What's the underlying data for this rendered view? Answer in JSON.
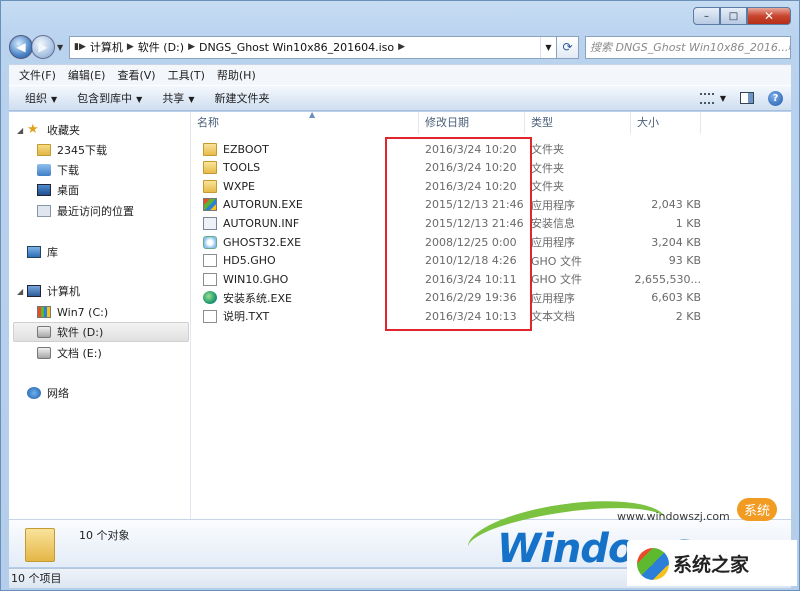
{
  "caption": {
    "minimize": "–",
    "maximize": "□",
    "close": "✕"
  },
  "address": {
    "crumbs": [
      "计算机",
      "软件 (D:)",
      "DNGS_Ghost Win10x86_201604.iso"
    ],
    "search_placeholder": "搜索 DNGS_Ghost Win10x86_2016..."
  },
  "menu": [
    "文件(F)",
    "编辑(E)",
    "查看(V)",
    "工具(T)",
    "帮助(H)"
  ],
  "toolbar": {
    "organize": "组织",
    "include_library": "包含到库中",
    "share": "共享",
    "new_folder": "新建文件夹"
  },
  "nav": {
    "favorites": "收藏夹",
    "fav_items": [
      "2345下载",
      "下载",
      "桌面",
      "最近访问的位置"
    ],
    "libraries": "库",
    "computer": "计算机",
    "drives": [
      "Win7 (C:)",
      "软件 (D:)",
      "文档 (E:)"
    ],
    "network": "网络"
  },
  "columns": {
    "name": "名称",
    "date": "修改日期",
    "type": "类型",
    "size": "大小"
  },
  "files": [
    {
      "name": "EZBOOT",
      "date": "2016/3/24 10:20",
      "type": "文件夹",
      "size": "",
      "icon": "folder-icon"
    },
    {
      "name": "TOOLS",
      "date": "2016/3/24 10:20",
      "type": "文件夹",
      "size": "",
      "icon": "folder-icon"
    },
    {
      "name": "WXPE",
      "date": "2016/3/24 10:20",
      "type": "文件夹",
      "size": "",
      "icon": "folder-icon"
    },
    {
      "name": "AUTORUN.EXE",
      "date": "2015/12/13 21:46",
      "type": "应用程序",
      "size": "2,043 KB",
      "icon": "exe-icon"
    },
    {
      "name": "AUTORUN.INF",
      "date": "2015/12/13 21:46",
      "type": "安装信息",
      "size": "1 KB",
      "icon": "inf-icon"
    },
    {
      "name": "GHOST32.EXE",
      "date": "2008/12/25 0:00",
      "type": "应用程序",
      "size": "3,204 KB",
      "icon": "ghost-icon"
    },
    {
      "name": "HD5.GHO",
      "date": "2010/12/18 4:26",
      "type": "GHO 文件",
      "size": "93 KB",
      "icon": "document-icon"
    },
    {
      "name": "WIN10.GHO",
      "date": "2016/3/24 10:11",
      "type": "GHO 文件",
      "size": "2,655,530...",
      "icon": "document-icon"
    },
    {
      "name": "安装系统.EXE",
      "date": "2016/2/29 19:36",
      "type": "应用程序",
      "size": "6,603 KB",
      "icon": "setup-icon"
    },
    {
      "name": "说明.TXT",
      "date": "2016/3/24 10:13",
      "type": "文本文档",
      "size": "2 KB",
      "icon": "document-icon"
    }
  ],
  "details": {
    "count": "10 个对象"
  },
  "status": {
    "count": "10 个项目"
  },
  "watermark": {
    "url": "www.windowszj.com",
    "badge": "系统",
    "big": "Windows",
    "cn": "系统之家"
  },
  "colors": {
    "highlight_box": "#e0262b",
    "title_bar": "#b9d2ee"
  }
}
